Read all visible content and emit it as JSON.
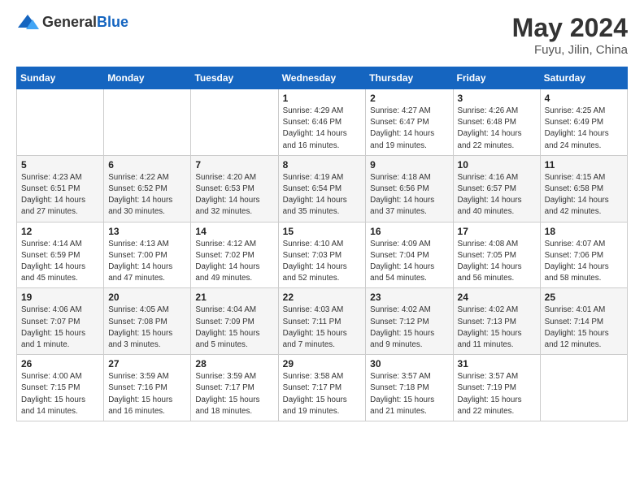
{
  "header": {
    "logo_general": "General",
    "logo_blue": "Blue",
    "title": "May 2024",
    "location": "Fuyu, Jilin, China"
  },
  "weekdays": [
    "Sunday",
    "Monday",
    "Tuesday",
    "Wednesday",
    "Thursday",
    "Friday",
    "Saturday"
  ],
  "weeks": [
    [
      {
        "day": "",
        "info": ""
      },
      {
        "day": "",
        "info": ""
      },
      {
        "day": "",
        "info": ""
      },
      {
        "day": "1",
        "info": "Sunrise: 4:29 AM\nSunset: 6:46 PM\nDaylight: 14 hours\nand 16 minutes."
      },
      {
        "day": "2",
        "info": "Sunrise: 4:27 AM\nSunset: 6:47 PM\nDaylight: 14 hours\nand 19 minutes."
      },
      {
        "day": "3",
        "info": "Sunrise: 4:26 AM\nSunset: 6:48 PM\nDaylight: 14 hours\nand 22 minutes."
      },
      {
        "day": "4",
        "info": "Sunrise: 4:25 AM\nSunset: 6:49 PM\nDaylight: 14 hours\nand 24 minutes."
      }
    ],
    [
      {
        "day": "5",
        "info": "Sunrise: 4:23 AM\nSunset: 6:51 PM\nDaylight: 14 hours\nand 27 minutes."
      },
      {
        "day": "6",
        "info": "Sunrise: 4:22 AM\nSunset: 6:52 PM\nDaylight: 14 hours\nand 30 minutes."
      },
      {
        "day": "7",
        "info": "Sunrise: 4:20 AM\nSunset: 6:53 PM\nDaylight: 14 hours\nand 32 minutes."
      },
      {
        "day": "8",
        "info": "Sunrise: 4:19 AM\nSunset: 6:54 PM\nDaylight: 14 hours\nand 35 minutes."
      },
      {
        "day": "9",
        "info": "Sunrise: 4:18 AM\nSunset: 6:56 PM\nDaylight: 14 hours\nand 37 minutes."
      },
      {
        "day": "10",
        "info": "Sunrise: 4:16 AM\nSunset: 6:57 PM\nDaylight: 14 hours\nand 40 minutes."
      },
      {
        "day": "11",
        "info": "Sunrise: 4:15 AM\nSunset: 6:58 PM\nDaylight: 14 hours\nand 42 minutes."
      }
    ],
    [
      {
        "day": "12",
        "info": "Sunrise: 4:14 AM\nSunset: 6:59 PM\nDaylight: 14 hours\nand 45 minutes."
      },
      {
        "day": "13",
        "info": "Sunrise: 4:13 AM\nSunset: 7:00 PM\nDaylight: 14 hours\nand 47 minutes."
      },
      {
        "day": "14",
        "info": "Sunrise: 4:12 AM\nSunset: 7:02 PM\nDaylight: 14 hours\nand 49 minutes."
      },
      {
        "day": "15",
        "info": "Sunrise: 4:10 AM\nSunset: 7:03 PM\nDaylight: 14 hours\nand 52 minutes."
      },
      {
        "day": "16",
        "info": "Sunrise: 4:09 AM\nSunset: 7:04 PM\nDaylight: 14 hours\nand 54 minutes."
      },
      {
        "day": "17",
        "info": "Sunrise: 4:08 AM\nSunset: 7:05 PM\nDaylight: 14 hours\nand 56 minutes."
      },
      {
        "day": "18",
        "info": "Sunrise: 4:07 AM\nSunset: 7:06 PM\nDaylight: 14 hours\nand 58 minutes."
      }
    ],
    [
      {
        "day": "19",
        "info": "Sunrise: 4:06 AM\nSunset: 7:07 PM\nDaylight: 15 hours\nand 1 minute."
      },
      {
        "day": "20",
        "info": "Sunrise: 4:05 AM\nSunset: 7:08 PM\nDaylight: 15 hours\nand 3 minutes."
      },
      {
        "day": "21",
        "info": "Sunrise: 4:04 AM\nSunset: 7:09 PM\nDaylight: 15 hours\nand 5 minutes."
      },
      {
        "day": "22",
        "info": "Sunrise: 4:03 AM\nSunset: 7:11 PM\nDaylight: 15 hours\nand 7 minutes."
      },
      {
        "day": "23",
        "info": "Sunrise: 4:02 AM\nSunset: 7:12 PM\nDaylight: 15 hours\nand 9 minutes."
      },
      {
        "day": "24",
        "info": "Sunrise: 4:02 AM\nSunset: 7:13 PM\nDaylight: 15 hours\nand 11 minutes."
      },
      {
        "day": "25",
        "info": "Sunrise: 4:01 AM\nSunset: 7:14 PM\nDaylight: 15 hours\nand 12 minutes."
      }
    ],
    [
      {
        "day": "26",
        "info": "Sunrise: 4:00 AM\nSunset: 7:15 PM\nDaylight: 15 hours\nand 14 minutes."
      },
      {
        "day": "27",
        "info": "Sunrise: 3:59 AM\nSunset: 7:16 PM\nDaylight: 15 hours\nand 16 minutes."
      },
      {
        "day": "28",
        "info": "Sunrise: 3:59 AM\nSunset: 7:17 PM\nDaylight: 15 hours\nand 18 minutes."
      },
      {
        "day": "29",
        "info": "Sunrise: 3:58 AM\nSunset: 7:17 PM\nDaylight: 15 hours\nand 19 minutes."
      },
      {
        "day": "30",
        "info": "Sunrise: 3:57 AM\nSunset: 7:18 PM\nDaylight: 15 hours\nand 21 minutes."
      },
      {
        "day": "31",
        "info": "Sunrise: 3:57 AM\nSunset: 7:19 PM\nDaylight: 15 hours\nand 22 minutes."
      },
      {
        "day": "",
        "info": ""
      }
    ]
  ]
}
